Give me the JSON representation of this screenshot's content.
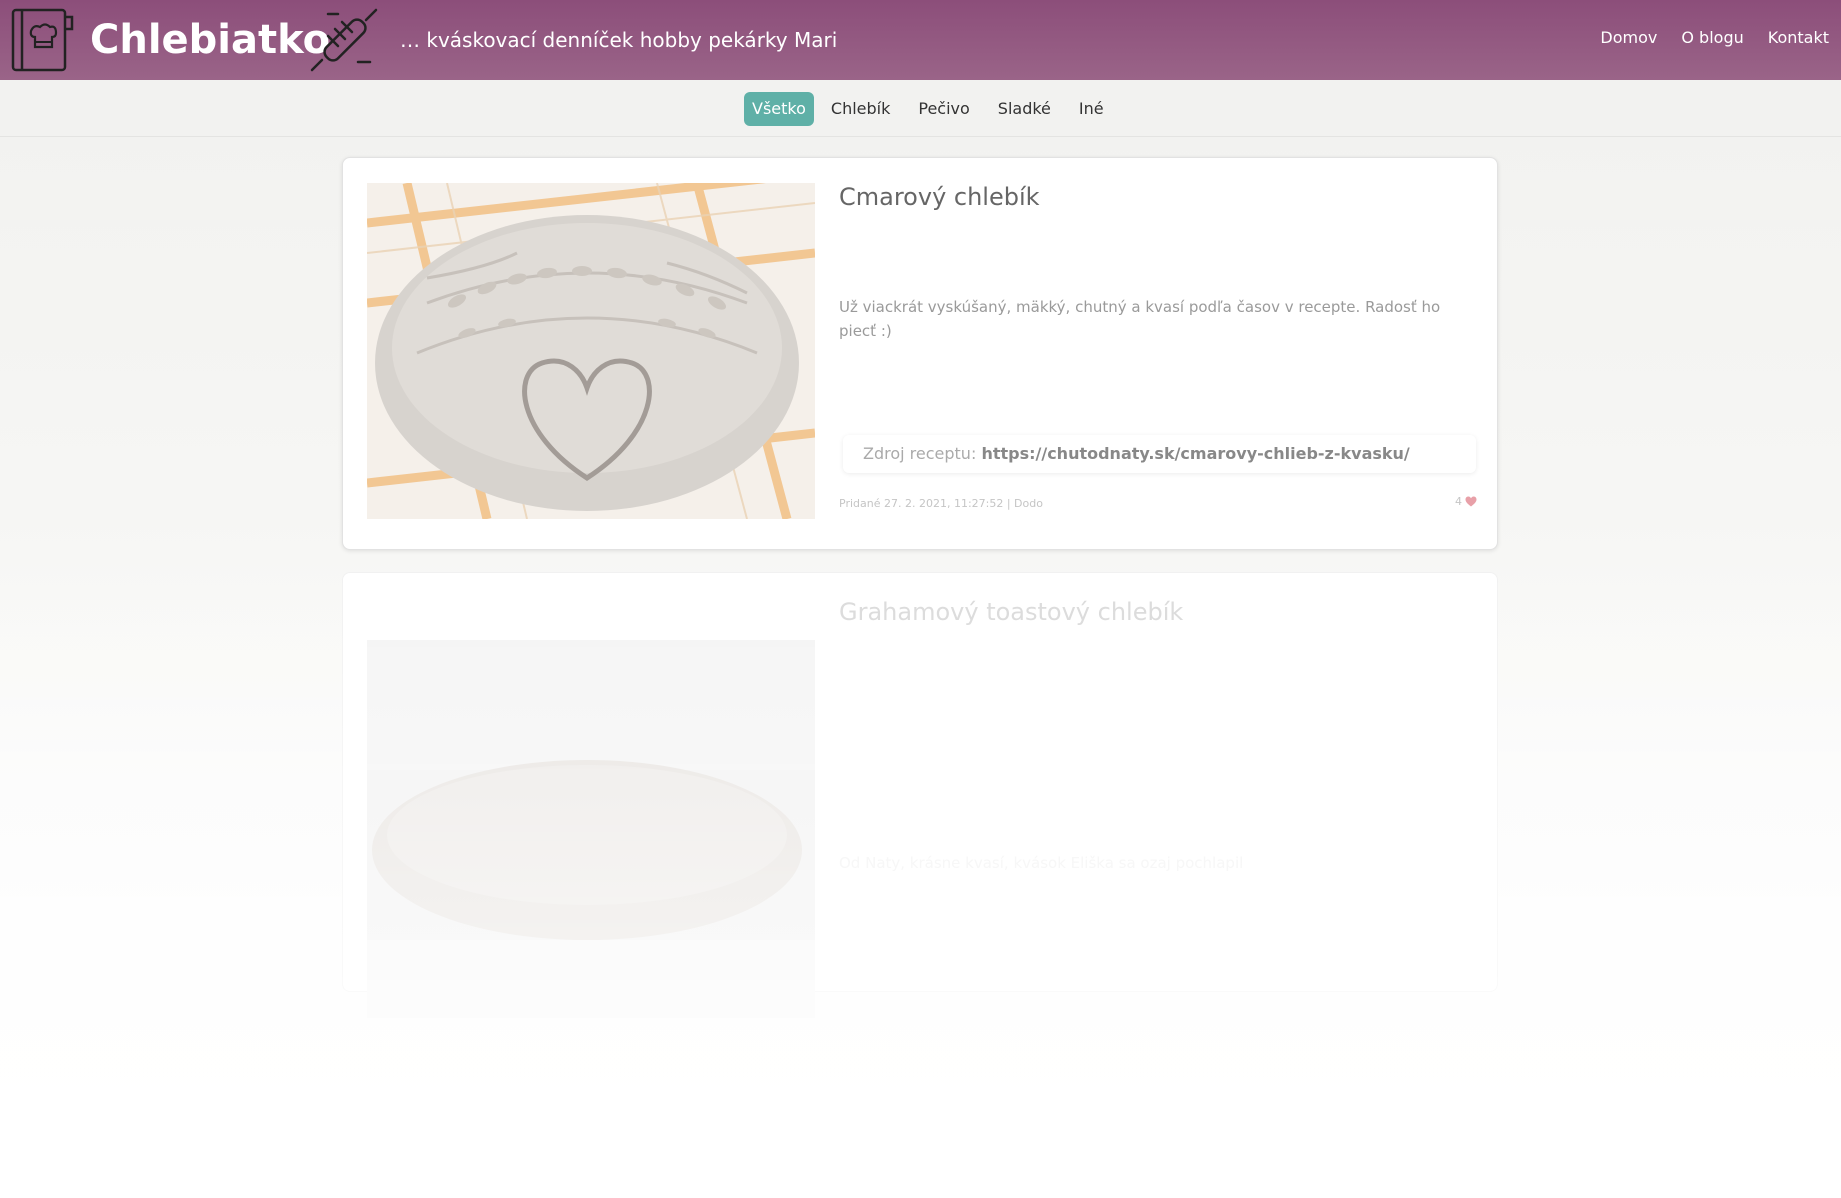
{
  "header": {
    "brand": "Chlebiatko",
    "tagline": "… kváskovací denníček hobby pekárky Mari",
    "nav": [
      "Domov",
      "O blogu",
      "Kontakt"
    ],
    "icons": [
      "recipe-book-icon",
      "rolling-pin-icon"
    ]
  },
  "categories": [
    "Všetko",
    "Chlebík",
    "Pečivo",
    "Sladké",
    "Iné"
  ],
  "active_category": "Všetko",
  "posts": [
    {
      "title": "Cmarový chlebík",
      "excerpt": "Už viackrát vyskúšaný, mäkký, chutný a kvasí podľa časov v recepte. Radosť ho piecť :)",
      "source_label": "Zdroj receptu:",
      "source_url": "https://chutodnaty.sk/cmarovy-chlieb-z-kvasku/",
      "meta": "Pridané 27. 2. 2021, 11:27:52 | Dodo",
      "likes": "4"
    },
    {
      "title": "Grahamový toastový chlebík",
      "excerpt": "Od Naty, krásne kvasí, kvások Eliška sa ozaj pochlapil"
    }
  ],
  "colors": {
    "header": "#8c4e7a",
    "accent": "#5fb0a7",
    "heart": "#e8a0a8"
  }
}
